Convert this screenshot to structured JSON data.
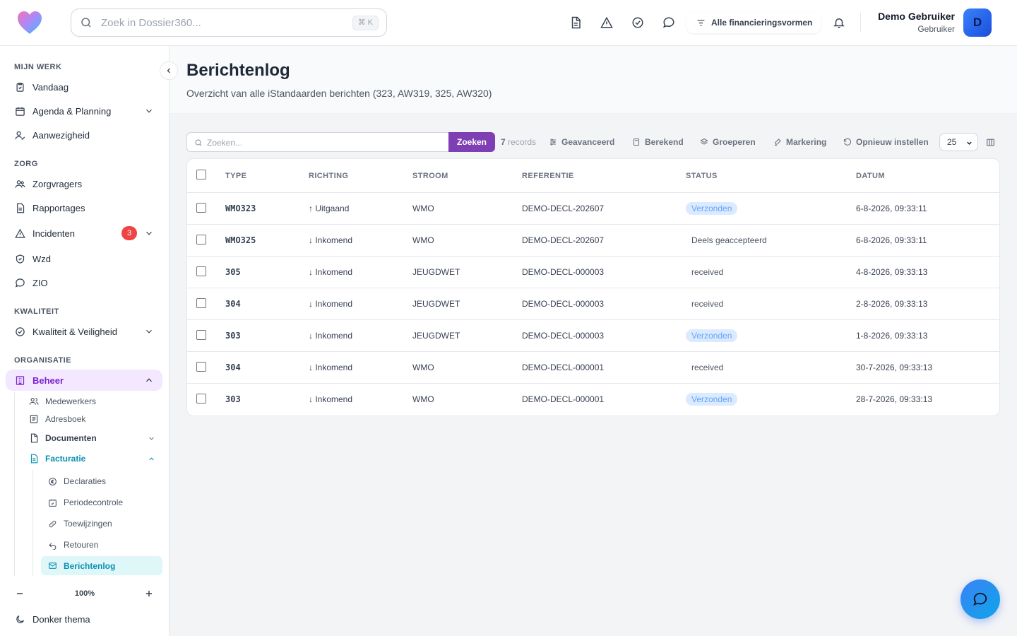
{
  "header": {
    "search_placeholder": "Zoek in Dossier360...",
    "search_shortcut": "⌘ K",
    "financing_label": "Alle financieringsvormen",
    "user_name": "Demo Gebruiker",
    "user_role": "Gebruiker",
    "avatar_initial": "D"
  },
  "sidebar": {
    "sections": {
      "mijn_werk": "MIJN WERK",
      "zorg": "ZORG",
      "kwaliteit": "KWALITEIT",
      "organisatie": "ORGANISATIE"
    },
    "items": {
      "vandaag": "Vandaag",
      "agenda": "Agenda & Planning",
      "aanwezigheid": "Aanwezigheid",
      "zorgvragers": "Zorgvragers",
      "rapportages": "Rapportages",
      "incidenten": "Incidenten",
      "incidenten_count": "3",
      "wzd": "Wzd",
      "zio": "ZIO",
      "kwaliteit_veiligheid": "Kwaliteit & Veiligheid",
      "beheer": "Beheer",
      "medewerkers": "Medewerkers",
      "adresboek": "Adresboek",
      "documenten": "Documenten",
      "facturatie": "Facturatie",
      "declaraties": "Declaraties",
      "periodecontrole": "Periodecontrole",
      "toewijzingen": "Toewijzingen",
      "retouren": "Retouren",
      "berichtenlog": "Berichtenlog"
    },
    "zoom_level": "100%",
    "theme_label": "Donker thema"
  },
  "page": {
    "title": "Berichtenlog",
    "subtitle": "Overzicht van alle iStandaarden berichten (323, AW319, 325, AW320)"
  },
  "toolbar": {
    "search_placeholder": "Zoeken...",
    "search_button": "Zoeken",
    "records_count": "7",
    "records_label": "records",
    "advanced": "Geavanceerd",
    "computed": "Berekend",
    "group": "Groeperen",
    "highlight": "Markering",
    "reset": "Opnieuw instellen",
    "page_size": "25"
  },
  "table": {
    "columns": [
      "TYPE",
      "RICHTING",
      "STROOM",
      "REFERENTIE",
      "STATUS",
      "DATUM"
    ],
    "rows": [
      {
        "type": "WMO323",
        "direction": "↑ Uitgaand",
        "stream": "WMO",
        "reference": "DEMO-DECL-202607",
        "status": "Verzonden",
        "status_style": "blue",
        "date": "6-8-2026, 09:33:11"
      },
      {
        "type": "WMO325",
        "direction": "↓ Inkomend",
        "stream": "WMO",
        "reference": "DEMO-DECL-202607",
        "status": "Deels geaccepteerd",
        "status_style": "plain",
        "date": "6-8-2026, 09:33:11"
      },
      {
        "type": "305",
        "direction": "↓ Inkomend",
        "stream": "JEUGDWET",
        "reference": "DEMO-DECL-000003",
        "status": "received",
        "status_style": "plain",
        "date": "4-8-2026, 09:33:13"
      },
      {
        "type": "304",
        "direction": "↓ Inkomend",
        "stream": "JEUGDWET",
        "reference": "DEMO-DECL-000003",
        "status": "received",
        "status_style": "plain",
        "date": "2-8-2026, 09:33:13"
      },
      {
        "type": "303",
        "direction": "↓ Inkomend",
        "stream": "JEUGDWET",
        "reference": "DEMO-DECL-000003",
        "status": "Verzonden",
        "status_style": "blue",
        "date": "1-8-2026, 09:33:13"
      },
      {
        "type": "304",
        "direction": "↓ Inkomend",
        "stream": "WMO",
        "reference": "DEMO-DECL-000001",
        "status": "received",
        "status_style": "plain",
        "date": "30-7-2026, 09:33:13"
      },
      {
        "type": "303",
        "direction": "↓ Inkomend",
        "stream": "WMO",
        "reference": "DEMO-DECL-000001",
        "status": "Verzonden",
        "status_style": "blue",
        "date": "28-7-2026, 09:33:13"
      }
    ]
  },
  "colors": {
    "accent_purple": "#7e3fb5",
    "active_teal": "#0891b2",
    "status_blue": "#60a5fa",
    "badge_red": "#ef4444"
  }
}
